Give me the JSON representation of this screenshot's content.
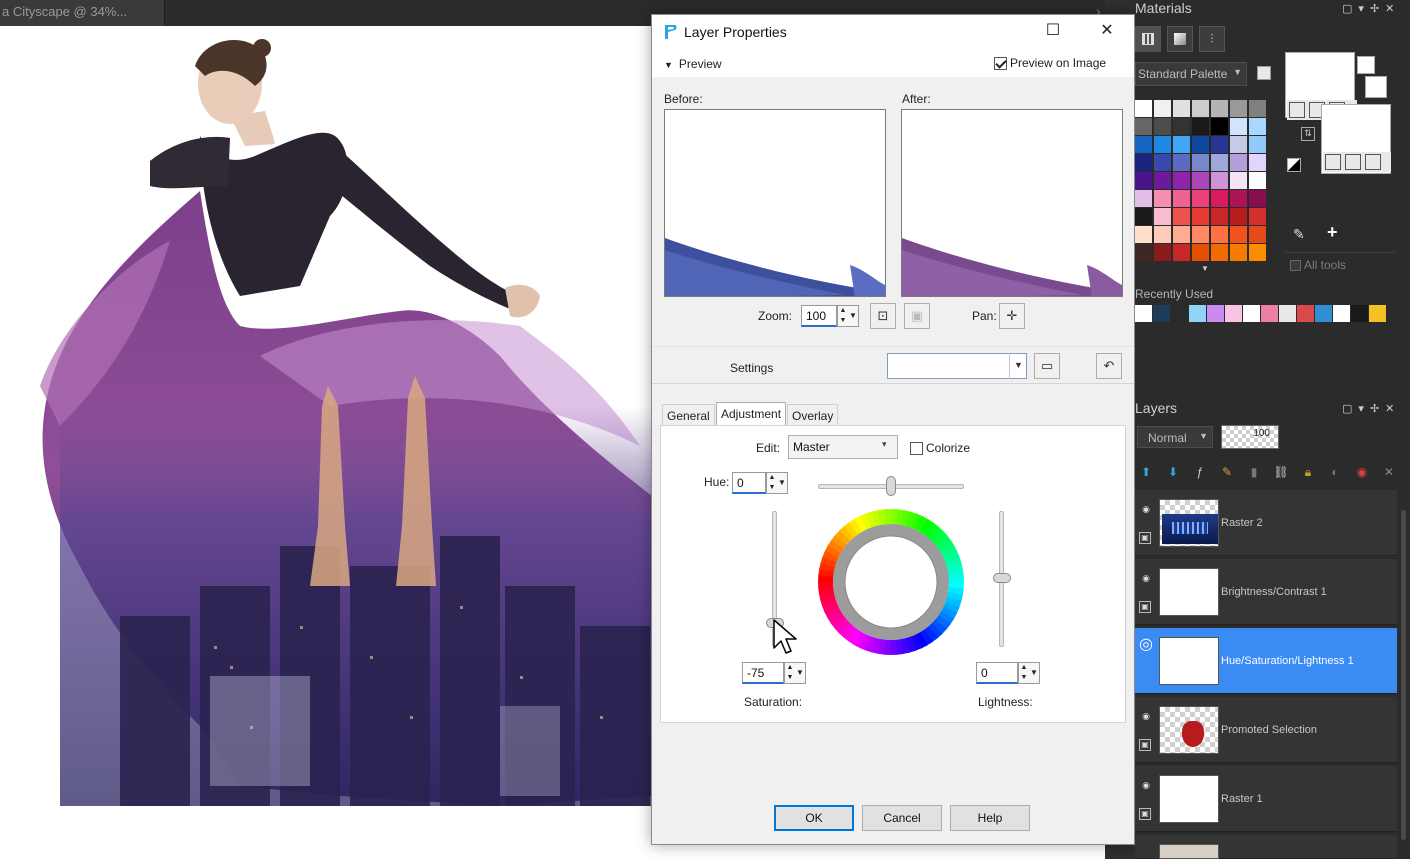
{
  "document": {
    "tab_title": "a Cityscape @  34%...",
    "chevron": "›"
  },
  "dialog": {
    "title": "Layer Properties",
    "minimize_icon": "minimize-icon",
    "maximize_icon": "maximize-icon",
    "close_icon": "close-icon",
    "preview_toggle": "Preview",
    "preview_on_image": {
      "label": "Preview on Image",
      "checked": true
    },
    "before_label": "Before:",
    "after_label": "After:",
    "zoom": {
      "label": "Zoom:",
      "value": "100"
    },
    "pan_label": "Pan:",
    "settings": {
      "label": "Settings",
      "value": ""
    },
    "tabs": [
      "General",
      "Adjustment",
      "Overlay"
    ],
    "active_tab": "Adjustment",
    "edit": {
      "label": "Edit:",
      "value": "Master"
    },
    "colorize": {
      "label": "Colorize",
      "checked": false
    },
    "hue": {
      "label": "Hue:",
      "value": "0"
    },
    "saturation": {
      "label": "Saturation:",
      "value": "-75"
    },
    "lightness": {
      "label": "Lightness:",
      "value": "0"
    },
    "buttons": {
      "ok": "OK",
      "cancel": "Cancel",
      "help": "Help"
    }
  },
  "materials": {
    "title": "Materials",
    "palette_dropdown": "Standard Palette",
    "all_tools_label": "All tools",
    "recently_used_label": "Recently Used",
    "recent_colors": [
      "#ffffff",
      "#1f3b5a",
      "#2a2a2a",
      "#8fd4f5",
      "#c98bf0",
      "#f7c4e4",
      "#ffffff",
      "#f07fa8",
      "#e8e8e8",
      "#d94a4a",
      "#2f8fd2",
      "#ffffff",
      "#1a1a1a",
      "#f5c120"
    ]
  },
  "layers": {
    "title": "Layers",
    "blend_mode": "Normal",
    "opacity": "100",
    "items": [
      {
        "name": "Raster 2",
        "thumb": "city"
      },
      {
        "name": "Brightness/Contrast 1",
        "thumb": "white"
      },
      {
        "name": "Hue/Saturation/Lightness 1",
        "thumb": "white",
        "selected": true
      },
      {
        "name": "Promoted Selection",
        "thumb": "dress"
      },
      {
        "name": "Raster 1",
        "thumb": "white"
      }
    ]
  },
  "colors": {
    "accent": "#3a8bf4",
    "panel_bg": "#2b2b2b",
    "arrow": "#e8403c"
  }
}
